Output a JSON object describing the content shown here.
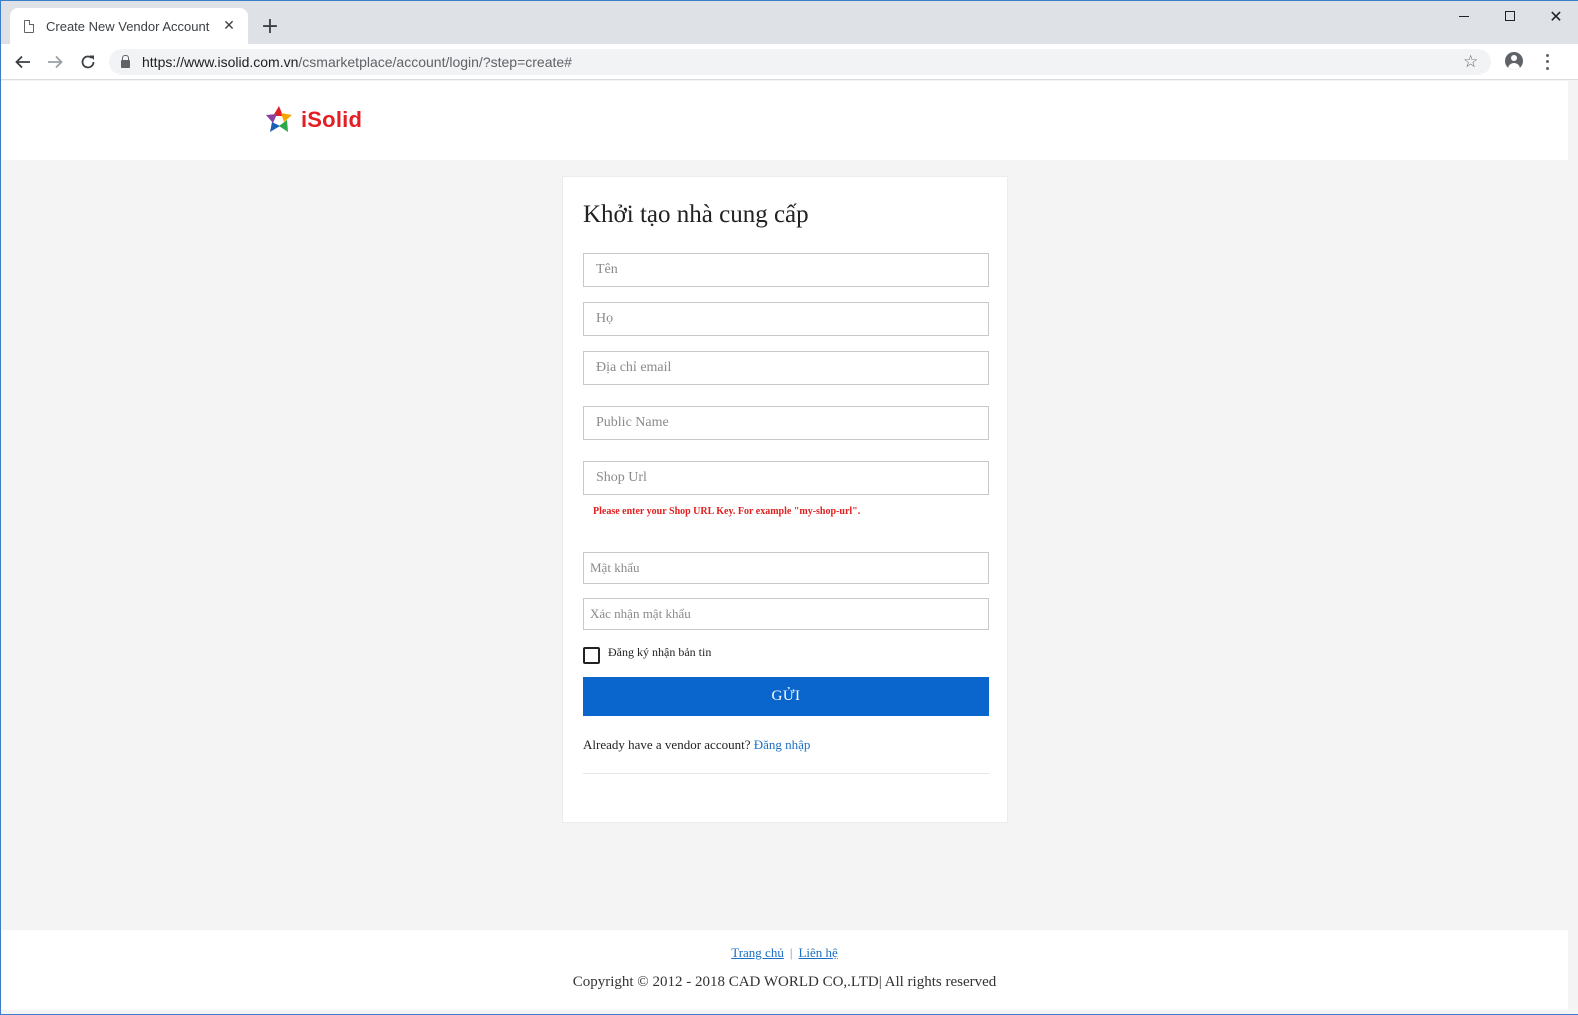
{
  "browser": {
    "tab_title": "Create New Vendor Account",
    "tab_close": "✕",
    "new_tab": "+",
    "url_host": "https://www.isolid.com.vn",
    "url_path": "/csmarketplace/account/login/?step=create#"
  },
  "header": {
    "logo_text": "iSolid"
  },
  "form": {
    "title": "Khởi tạo nhà cung cấp",
    "first_name_placeholder": "Tên",
    "last_name_placeholder": "Họ",
    "email_placeholder": "Địa chỉ email",
    "public_name_placeholder": "Public Name",
    "shop_url_placeholder": "Shop Url",
    "shop_url_note": "Please enter your Shop URL Key. For example \"my-shop-url\".",
    "password_placeholder": "Mật khẩu",
    "confirm_password_placeholder": "Xác nhận mật khẩu",
    "newsletter_label": "Đăng ký nhận bản tin",
    "submit_label": "GỬI",
    "login_prompt": "Already have a vendor account?",
    "login_link": "Đăng nhập"
  },
  "footer": {
    "home_link": "Trang chủ",
    "separator": "|",
    "contact_link": "Liên hệ",
    "copyright": "Copyright © 2012 - 2018 CAD WORLD CO,.LTD| All rights reserved"
  },
  "colors": {
    "brand_red": "#e31e24",
    "submit_blue": "#0a66cc",
    "link_blue": "#1a6fc4",
    "error_red": "#e02020"
  }
}
